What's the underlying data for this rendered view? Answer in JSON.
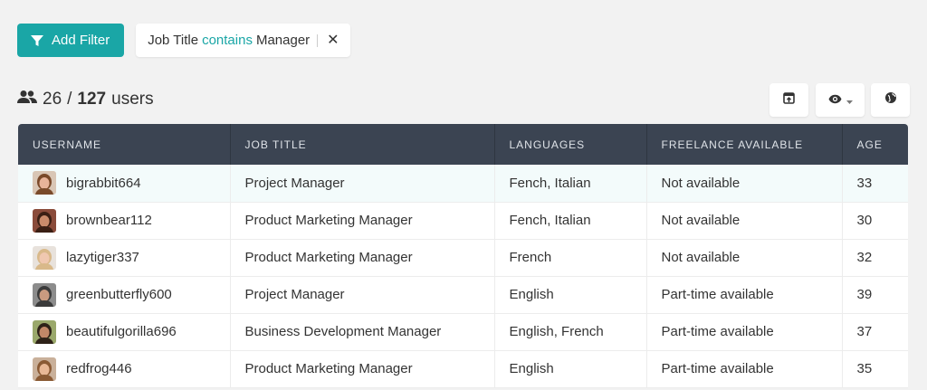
{
  "toolbar": {
    "add_filter_label": "Add Filter",
    "filter_chip": {
      "field": "Job Title",
      "operator": "contains",
      "value": "Manager"
    }
  },
  "summary": {
    "shown": "26",
    "separator": "/",
    "total": "127",
    "unit": "users"
  },
  "colors": {
    "accent": "#1aa6a6",
    "header_bg": "#3b4452"
  },
  "table": {
    "columns": [
      "USERNAME",
      "JOB TITLE",
      "LANGUAGES",
      "FREELANCE AVAILABLE",
      "AGE"
    ],
    "rows": [
      {
        "username": "bigrabbit664",
        "job": "Project Manager",
        "languages": "Fench, Italian",
        "freelance": "Not available",
        "age": "33",
        "avatar": {
          "skin": "#e8b49a",
          "hair": "#7a4a2a",
          "bg": "#d9c6b5"
        }
      },
      {
        "username": "brownbear112",
        "job": "Product Marketing Manager",
        "languages": "Fench, Italian",
        "freelance": "Not available",
        "age": "30",
        "avatar": {
          "skin": "#c98b6b",
          "hair": "#3a1f14",
          "bg": "#8a4b3a"
        }
      },
      {
        "username": "lazytiger337",
        "job": "Product Marketing Manager",
        "languages": "French",
        "freelance": "Not available",
        "age": "32",
        "avatar": {
          "skin": "#f0c8b0",
          "hair": "#d9b98a",
          "bg": "#e8e2dc"
        }
      },
      {
        "username": "greenbutterfly600",
        "job": "Project Manager",
        "languages": "English",
        "freelance": "Part-time available",
        "age": "39",
        "avatar": {
          "skin": "#c99a80",
          "hair": "#3b3b3b",
          "bg": "#8c8c8c"
        }
      },
      {
        "username": "beautifulgorilla696",
        "job": "Business Development Manager",
        "languages": "English, French",
        "freelance": "Part-time available",
        "age": "37",
        "avatar": {
          "skin": "#c28868",
          "hair": "#2e2218",
          "bg": "#9aa86b"
        }
      },
      {
        "username": "redfrog446",
        "job": "Product Marketing Manager",
        "languages": "English",
        "freelance": "Part-time available",
        "age": "35",
        "avatar": {
          "skin": "#e8b896",
          "hair": "#8a5a34",
          "bg": "#c9b09a"
        }
      }
    ]
  }
}
